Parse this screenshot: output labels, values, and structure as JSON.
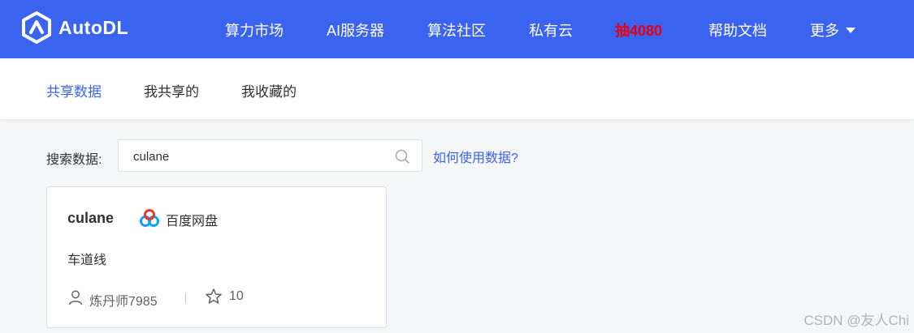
{
  "header": {
    "brand": "AutoDL",
    "nav": [
      {
        "label": "算力市场"
      },
      {
        "label": "AI服务器"
      },
      {
        "label": "算法社区"
      },
      {
        "label": "私有云"
      },
      {
        "label": "抽4080"
      },
      {
        "label": "帮助文档"
      },
      {
        "label": "更多"
      }
    ]
  },
  "tabs": [
    {
      "label": "共享数据",
      "active": true
    },
    {
      "label": "我共享的"
    },
    {
      "label": "我收藏的"
    }
  ],
  "search": {
    "label": "搜索数据:",
    "value": "culane",
    "help_link": "如何使用数据?"
  },
  "card": {
    "title": "culane",
    "source": "百度网盘",
    "description": "车道线",
    "author": "炼丹师7985",
    "stars": "10"
  },
  "watermark": "CSDN @友人Chi",
  "colors": {
    "brand": "#3a63ef",
    "hot": "#e60012"
  }
}
